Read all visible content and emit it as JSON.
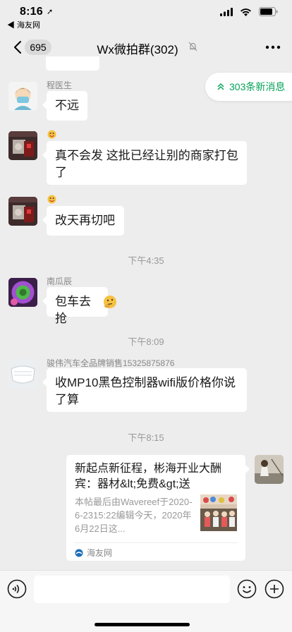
{
  "status_bar": {
    "time": "8:16",
    "back_app": "◀ 海友网"
  },
  "nav": {
    "unread_count": "695",
    "title": "Wx微拍群(302)"
  },
  "new_messages_pill": "303条新消息",
  "messages": [
    {
      "sender": "程医生",
      "text": "不远"
    },
    {
      "sender": "",
      "text": "真不会发    这批已经让别的商家打包了"
    },
    {
      "sender": "",
      "text": "改天再切吧"
    },
    {
      "sender": "南瓜辰",
      "text": "包车去抢"
    },
    {
      "sender": "骏伟汽车全品牌销售15325875876",
      "text": "收MP10黑色控制器wifi版价格你说了算"
    }
  ],
  "timestamps": [
    "下午4:35",
    "下午8:09",
    "下午8:15"
  ],
  "link_card": {
    "title": "新起点新征程，彬海开业大酬宾：器材&lt;免费&gt;送",
    "description": "本帖最后由Wavereef于2020-6-2315:22编辑今天，2020年6月22日这...",
    "source": "海友网"
  },
  "input": {
    "placeholder": ""
  },
  "colors": {
    "background": "#ededed",
    "bubble": "#ffffff",
    "accent_green": "#07a35a",
    "timestamp_gray": "#999999"
  }
}
